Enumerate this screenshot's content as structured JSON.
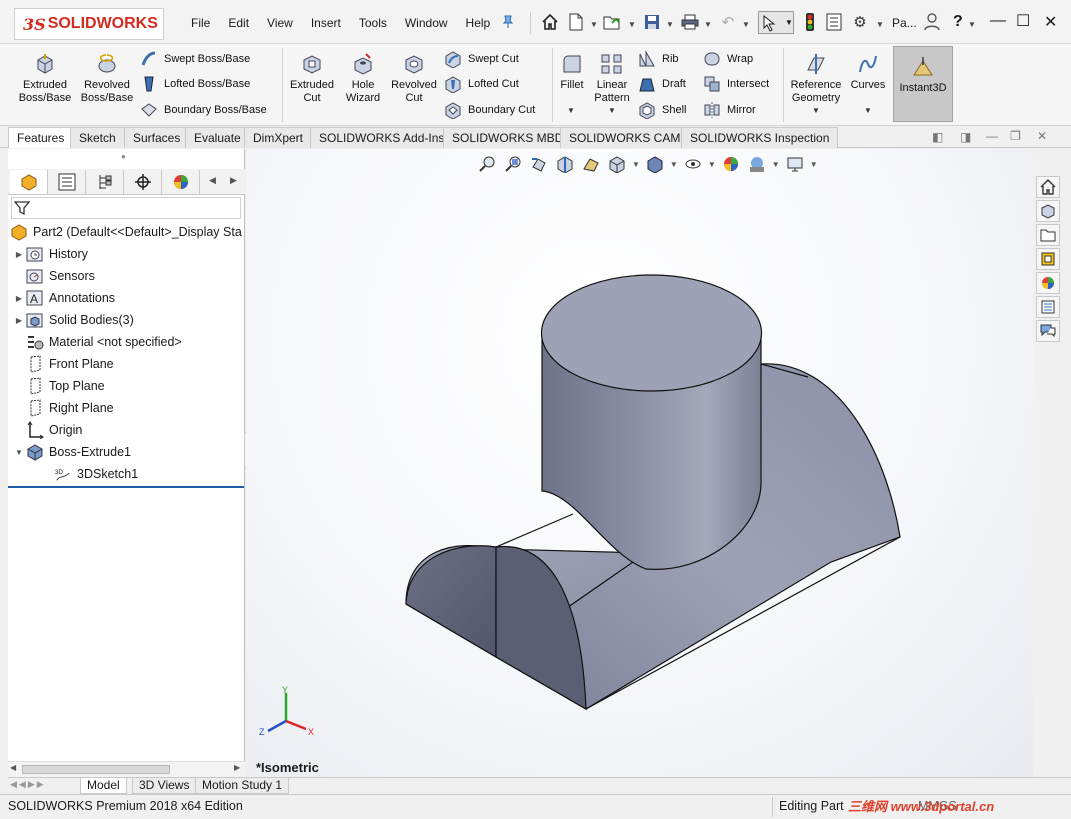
{
  "app": {
    "logo_text": "SOLIDWORKS",
    "menu": [
      "File",
      "Edit",
      "View",
      "Insert",
      "Tools",
      "Window",
      "Help"
    ],
    "user_short": "Pa...",
    "help_symbol": "?"
  },
  "command_manager": {
    "extruded_boss": "Extruded Boss/Base",
    "revolved_boss": "Revolved Boss/Base",
    "swept_boss": "Swept Boss/Base",
    "lofted_boss": "Lofted Boss/Base",
    "boundary_boss": "Boundary Boss/Base",
    "extruded_cut": "Extruded Cut",
    "hole_wizard": "Hole Wizard",
    "revolved_cut": "Revolved Cut",
    "swept_cut": "Swept Cut",
    "lofted_cut": "Lofted Cut",
    "boundary_cut": "Boundary Cut",
    "fillet": "Fillet",
    "linear_pattern": "Linear Pattern",
    "rib": "Rib",
    "draft": "Draft",
    "shell": "Shell",
    "wrap": "Wrap",
    "intersect": "Intersect",
    "mirror": "Mirror",
    "reference_geometry": "Reference Geometry",
    "curves": "Curves",
    "instant3d": "Instant3D"
  },
  "tabs": [
    "Features",
    "Sketch",
    "Surfaces",
    "Evaluate",
    "DimXpert",
    "SOLIDWORKS Add-Ins",
    "SOLIDWORKS MBD",
    "SOLIDWORKS CAM",
    "SOLIDWORKS Inspection"
  ],
  "active_tab": "Features",
  "feature_tree": {
    "root": "Part2  (Default<<Default>_Display Sta",
    "items": [
      {
        "label": "History",
        "icon": "history-icon",
        "expandable": true
      },
      {
        "label": "Sensors",
        "icon": "sensors-icon",
        "expandable": false
      },
      {
        "label": "Annotations",
        "icon": "annotations-icon",
        "expandable": true
      },
      {
        "label": "Solid Bodies(3)",
        "icon": "solid-bodies-icon",
        "expandable": true
      },
      {
        "label": "Material <not specified>",
        "icon": "material-icon",
        "expandable": false
      },
      {
        "label": "Front Plane",
        "icon": "plane-icon",
        "expandable": false
      },
      {
        "label": "Top Plane",
        "icon": "plane-icon",
        "expandable": false
      },
      {
        "label": "Right Plane",
        "icon": "plane-icon",
        "expandable": false
      },
      {
        "label": "Origin",
        "icon": "origin-icon",
        "expandable": false
      },
      {
        "label": "Boss-Extrude1",
        "icon": "extrude-icon",
        "expandable": true
      },
      {
        "label": "3DSketch1",
        "icon": "3dsketch-icon",
        "expandable": false
      }
    ]
  },
  "viewport": {
    "view_label": "*Isometric",
    "triad": {
      "x": "X",
      "y": "Y",
      "z": "Z"
    },
    "model_color": "#8e92a8"
  },
  "bottom_tabs": [
    "Model",
    "3D Views",
    "Motion Study 1"
  ],
  "active_bottom_tab": "Model",
  "status": {
    "edition": "SOLIDWORKS Premium 2018 x64 Edition",
    "mode": "Editing Part",
    "units": "MMGS",
    "watermark": "三维网 www.3dportal.cn"
  },
  "colors": {
    "brand": "#d52b1e",
    "selection_line": "#1f5aa8"
  }
}
